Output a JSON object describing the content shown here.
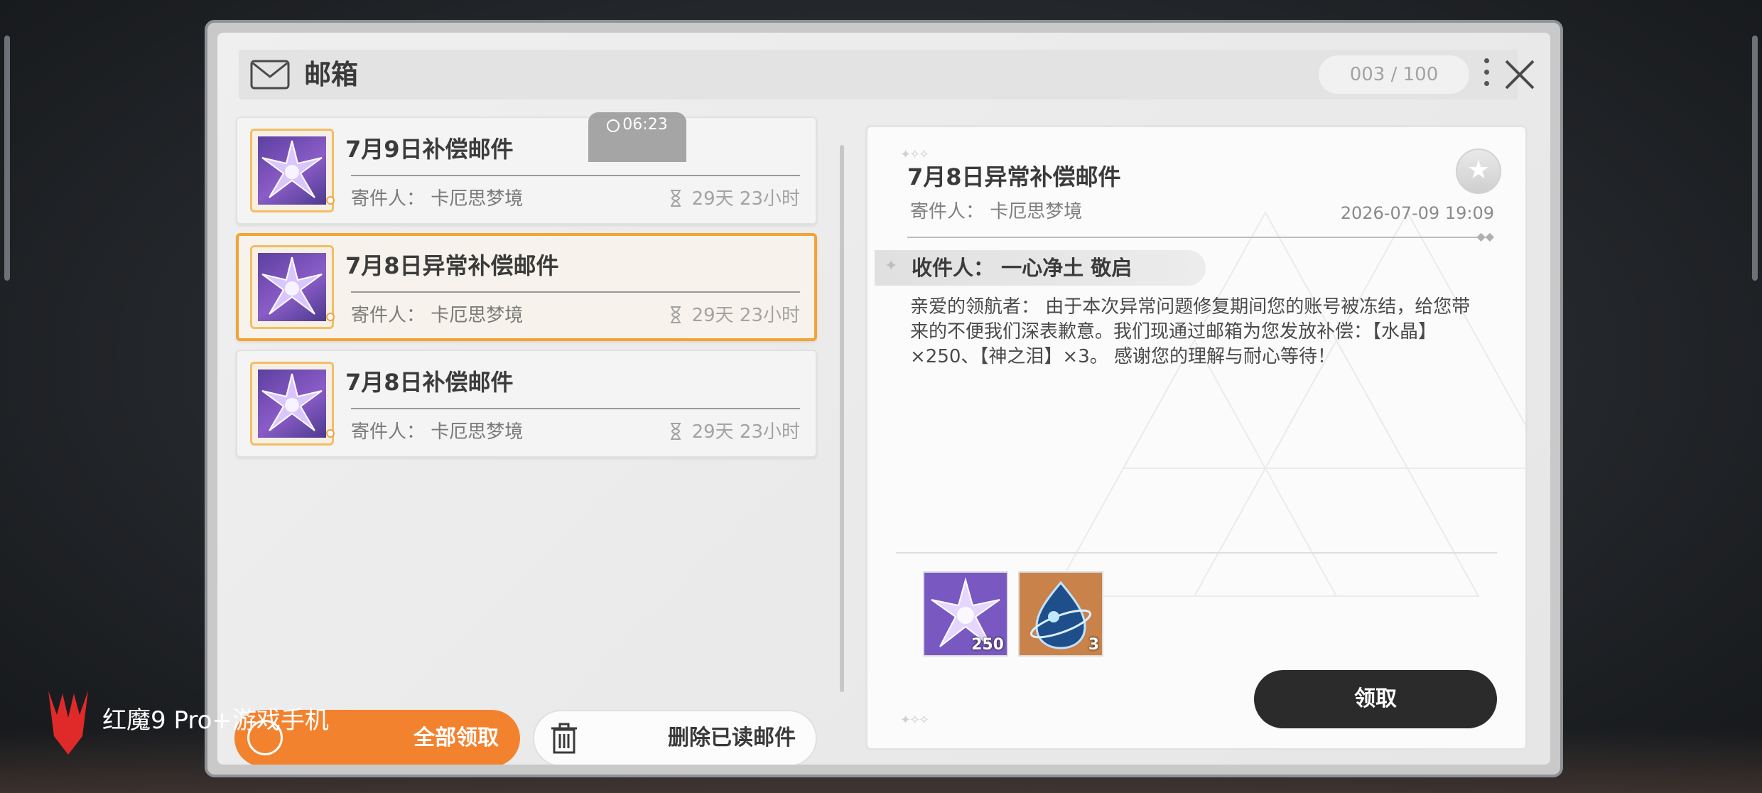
{
  "header": {
    "title": "邮箱",
    "counter": "003 / 100"
  },
  "time_tooltip": "06:23",
  "mails": [
    {
      "title": "7月9日补偿邮件",
      "sender": "寄件人：  卡厄思梦境",
      "expires": "29天 23小时",
      "selected": false
    },
    {
      "title": "7月8日异常补偿邮件",
      "sender": "寄件人：  卡厄思梦境",
      "expires": "29天 23小时",
      "selected": true
    },
    {
      "title": "7月8日补偿邮件",
      "sender": "寄件人：  卡厄思梦境",
      "expires": "29天 23小时",
      "selected": false
    }
  ],
  "buttons": {
    "claim_all": "全部领取",
    "delete_read": "删除已读邮件",
    "claim": "领取"
  },
  "detail": {
    "title": "7月8日异常补偿邮件",
    "sender": "寄件人：  卡厄思梦境",
    "date": "2026-07-09 19:09",
    "recipient": "收件人：  一心净土 敬启",
    "body": "亲爱的领航者：  由于本次异常问题修复期间您的账号被冻结，给您带来的不便我们深表歉意。我们现通过邮箱为您发放补偿：【水晶】×250、【神之泪】×3。 感谢您的理解与耐心等待！",
    "rewards": [
      {
        "name": "crystal-icon",
        "qty": "250",
        "color": "#7a58c2"
      },
      {
        "name": "tear-of-god-icon",
        "qty": "3",
        "color": "#c9824a"
      }
    ]
  },
  "watermark": "红魔9 Pro+游戏手机",
  "colors": {
    "accent_orange": "#f3822f",
    "selected_border": "#f3a334",
    "claim_button": "#2b2b2b"
  }
}
